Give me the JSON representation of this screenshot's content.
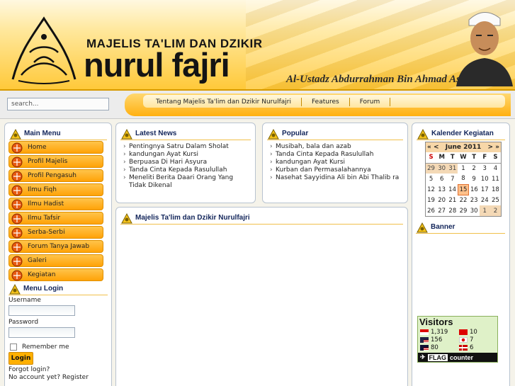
{
  "header": {
    "org_top": "MAJELIS TA'LIM DAN DZIKIR",
    "org_name": "nurul fajri",
    "ustadz": "Al-Ustadz Abdurrahman Bin Ahmad Assegaf"
  },
  "search": {
    "value": "search..."
  },
  "top_menu": [
    {
      "label": "Tentang Majelis Ta'lim dan Dzikir Nurulfajri"
    },
    {
      "label": "Features"
    },
    {
      "label": "Forum"
    }
  ],
  "main_menu": {
    "title": "Main Menu",
    "items": [
      "Home",
      "Profil Majelis",
      "Profil Pengasuh",
      "Ilmu Fiqh",
      "Ilmu Hadist",
      "Ilmu Tafsir",
      "Serba-Serbi",
      "Forum Tanya Jawab",
      "Galeri",
      "Kegiatan"
    ]
  },
  "login": {
    "title": "Menu Login",
    "username_label": "Username",
    "password_label": "Password",
    "remember_label": "Remember me",
    "button": "Login",
    "forgot": "Forgot login?",
    "register": "No account yet? Register"
  },
  "latest_news": {
    "title": "Latest News",
    "items": [
      "Pentingnya Satru Dalam Sholat",
      "kandungan Ayat Kursi",
      "Berpuasa Di Hari Asyura",
      "Tanda Cinta Kepada Rasulullah",
      "Meneliti Berita Daari Orang Yang Tidak Dikenal"
    ]
  },
  "popular": {
    "title": "Popular",
    "items": [
      "Musibah, bala dan azab",
      "Tanda Cinta Kepada Rasulullah",
      "kandungan Ayat Kursi",
      "Kurban dan Permasalahannya",
      "Nasehat Sayyidina Ali bin Abi Thalib ra"
    ]
  },
  "center": {
    "title": "Majelis Ta'lim dan Dzikir Nurulfajri"
  },
  "calendar": {
    "title": "Kalender Kegiatan",
    "prev_year": "«",
    "prev_month": "<",
    "month": "June 2011",
    "next_month": ">",
    "next_year": "»",
    "day_names": [
      "S",
      "M",
      "T",
      "W",
      "T",
      "F",
      "S"
    ],
    "weeks": [
      [
        "29",
        "30",
        "31",
        "1",
        "2",
        "3",
        "4"
      ],
      [
        "5",
        "6",
        "7",
        "8",
        "9",
        "10",
        "11"
      ],
      [
        "12",
        "13",
        "14",
        "15",
        "16",
        "17",
        "18"
      ],
      [
        "19",
        "20",
        "21",
        "22",
        "23",
        "24",
        "25"
      ],
      [
        "26",
        "27",
        "28",
        "29",
        "30",
        "1",
        "2"
      ]
    ]
  },
  "banner": {
    "title": "Banner"
  },
  "visitors": {
    "title": "Visitors",
    "rows": [
      {
        "count": "1,319",
        "flag": "indonesia"
      },
      {
        "count": "10",
        "flag": "china"
      },
      {
        "count": "156",
        "flag": "usa"
      },
      {
        "count": "7",
        "flag": "japan"
      },
      {
        "count": "80",
        "flag": "malaysia"
      },
      {
        "count": "6",
        "flag": "denmark"
      }
    ],
    "footer_flag": "FLAG",
    "footer_counter": "counter"
  },
  "colors": {
    "accent": "#ffa208",
    "title_text": "#12255a"
  }
}
